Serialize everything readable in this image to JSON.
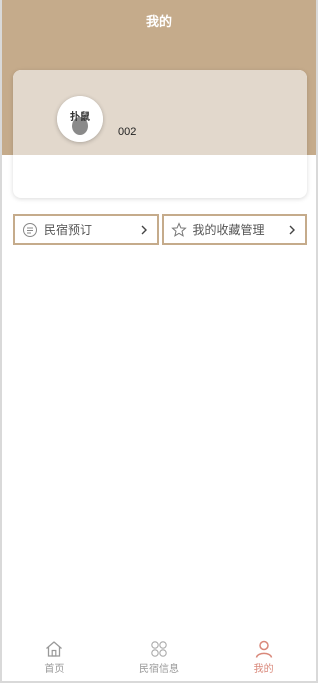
{
  "header": {
    "title": "我的"
  },
  "profile": {
    "avatar_icon": "avatar-image",
    "avatar_text": "扑鼠",
    "username": "002"
  },
  "menu": [
    {
      "label": "民宿预订",
      "icon": "booking-list-icon"
    },
    {
      "label": "我的收藏管理",
      "icon": "star-icon"
    }
  ],
  "tabbar": {
    "items": [
      {
        "label": "首页",
        "icon": "home-icon",
        "active": false
      },
      {
        "label": "民宿信息",
        "icon": "grid-icon",
        "active": false
      },
      {
        "label": "我的",
        "icon": "user-icon",
        "active": true
      }
    ]
  },
  "colors": {
    "brand": "#c5ab8b",
    "card_top": "#e2d8cc",
    "active_tab": "#d9887a",
    "inactive_tab": "#999999"
  }
}
